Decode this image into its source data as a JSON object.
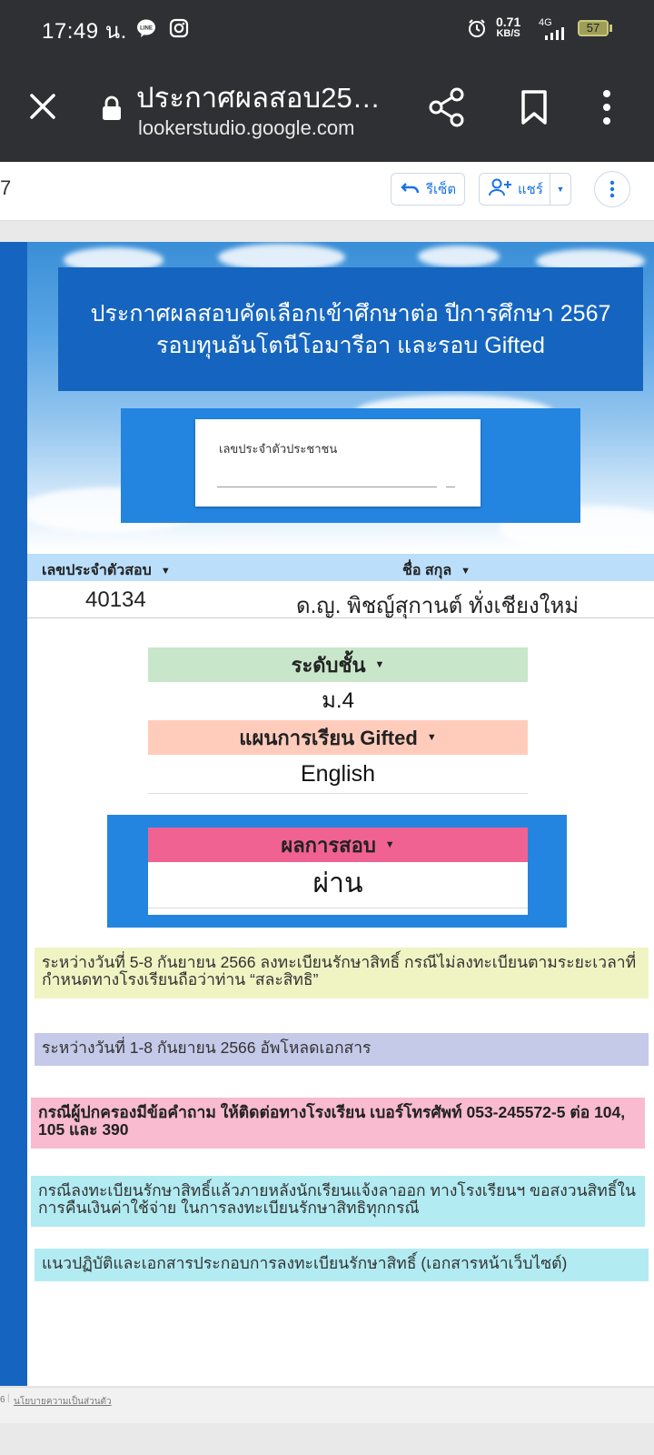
{
  "status_bar": {
    "time": "17:49 น.",
    "net_speed_value": "0.71",
    "net_speed_unit": "KB/S",
    "network": "4G",
    "battery": "57",
    "left_icons": [
      "line-app-icon",
      "instagram-icon"
    ],
    "right_icons": [
      "alarm-icon",
      "signal-icon",
      "battery-icon"
    ]
  },
  "browser": {
    "page_title": "ประกาศผลสอบ25…",
    "url": "lookerstudio.google.com"
  },
  "looker_header": {
    "page_number": "7",
    "reset_label": "รีเซ็ต",
    "share_label": "แชร์"
  },
  "report": {
    "title_line1": "ประกาศผลสอบคัดเลือกเข้าศึกษาต่อ ปีการศึกษา 2567",
    "title_line2": "รอบทุนอันโตนีโอมารีอา และรอบ Gifted",
    "input_label": "เลขประจำตัวประชาชน",
    "table": {
      "headers": [
        "เลขประจำตัวสอบ",
        "ชื่อ สกุล"
      ],
      "rows": [
        [
          "40134",
          "ด.ญ. พิชญ์สุกานต์ ทั่งเชียงใหม่"
        ]
      ]
    },
    "level": {
      "label": "ระดับชั้น",
      "value": "ม.4"
    },
    "program": {
      "label": "แผนการเรียน Gifted",
      "value": "English"
    },
    "result": {
      "label": "ผลการสอบ",
      "value": "ผ่าน"
    },
    "notes": [
      "ระหว่างวันที่ 5-8 กันยายน 2566 ลงทะเบียนรักษาสิทธิ์ กรณีไม่ลงทะเบียนตามระยะเวลาที่กำหนดทางโรงเรียนถือว่าท่าน “สละสิทธิ”",
      "ระหว่างวันที่ 1-8 กันยายน 2566 อัพโหลดเอกสาร",
      "กรณีผู้ปกครองมีข้อคำถาม ให้ติดต่อทางโรงเรียน เบอร์โทรศัพท์ 053-245572-5 ต่อ 104, 105 และ 390",
      "กรณีลงทะเบียนรักษาสิทธิ์แล้วภายหลังนักเรียนแจ้งลาออก ทางโรงเรียนฯ ขอสงวนสิทธิ์ในการคืนเงินค่าใช้จ่าย ในการลงทะเบียนรักษาสิทธิทุกกรณี",
      "แนวปฏิบัติและเอกสารประกอบการลงทะเบียนรักษาสิทธิ์ (เอกสารหน้าเว็บไซต์)"
    ],
    "note_colors": [
      "#f0f4c3",
      "#c5cae9",
      "#f8bbd0",
      "#b2ebf2",
      "#b2ebf2"
    ]
  },
  "footer": {
    "fragment": "6",
    "privacy_link": "นโยบายความเป็นส่วนตัว"
  },
  "colors": {
    "status_bg": "#2f3033",
    "title_bg": "#1565c0",
    "panel_blue": "#2385e0",
    "table_header": "#bbdefb",
    "level_header": "#c8e6c9",
    "program_header": "#ffccbc",
    "result_header": "#f06292"
  }
}
